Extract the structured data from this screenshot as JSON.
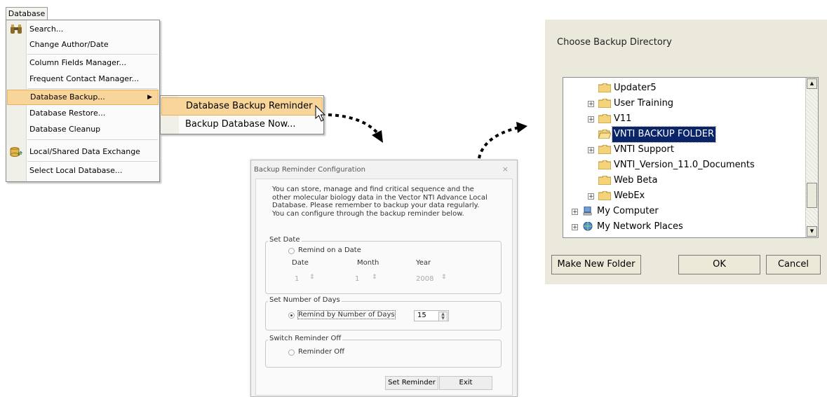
{
  "menu": {
    "tab_label": "Database",
    "items": [
      {
        "label": "Search...",
        "icon": "binoculars-icon"
      },
      {
        "label": "Change Author/Date"
      },
      {
        "label": "Column Fields Manager..."
      },
      {
        "label": "Frequent Contact Manager..."
      },
      {
        "label": "Database Backup...",
        "highlighted": true,
        "has_submenu": true
      },
      {
        "label": "Database Restore..."
      },
      {
        "label": "Database Cleanup"
      },
      {
        "label": "Local/Shared Data Exchange",
        "icon": "data-exchange-icon"
      },
      {
        "label": "Select Local Database..."
      }
    ],
    "submenu": [
      {
        "label": "Database Backup Reminder",
        "highlighted": true
      },
      {
        "label": "Backup Database Now..."
      }
    ],
    "highlight_color": "#f8d59a"
  },
  "reminder_dialog": {
    "title": "Backup Reminder Configuration",
    "close_glyph": "×",
    "description": "You can store, manage and find critical sequence and the other molecular biology data in the Vector NTI Advance Local Database. Please remember to backup your data regularly. You can configure through the  backup reminder below.",
    "set_date": {
      "group_title": "Set Date",
      "radio_label": "Remind on a Date",
      "selected": false,
      "date_label": "Date",
      "month_label": "Month",
      "year_label": "Year",
      "date_value": "1",
      "month_value": "1",
      "year_value": "2008"
    },
    "set_days": {
      "group_title": "Set Number of Days",
      "radio_label": "Remind by Number of Days",
      "selected": true,
      "days_value": "15"
    },
    "switch_off": {
      "group_title": "Switch Reminder Off",
      "radio_label": "Reminder Off",
      "selected": false
    },
    "set_reminder_label": "Set Reminder",
    "exit_label": "Exit"
  },
  "directory_dialog": {
    "title": "Choose Backup Directory",
    "tree": [
      {
        "label": "Updater5",
        "level": 2,
        "expandable": false
      },
      {
        "label": "User Training",
        "level": 2,
        "expandable": true
      },
      {
        "label": "V11",
        "level": 2,
        "expandable": true
      },
      {
        "label": "VNTI BACKUP FOLDER",
        "level": 2,
        "expandable": false,
        "selected": true
      },
      {
        "label": "VNTI Support",
        "level": 2,
        "expandable": true
      },
      {
        "label": "VNTI_Version_11.0_Documents",
        "level": 2,
        "expandable": false
      },
      {
        "label": "Web Beta",
        "level": 2,
        "expandable": false
      },
      {
        "label": "WebEx",
        "level": 2,
        "expandable": true
      },
      {
        "label": "My Computer",
        "level": 1,
        "expandable": true,
        "icon": "computer-icon"
      },
      {
        "label": "My Network Places",
        "level": 1,
        "expandable": true,
        "icon": "network-icon"
      }
    ],
    "make_new_folder_label": "Make New Folder",
    "ok_label": "OK",
    "cancel_label": "Cancel",
    "selection_color": "#0a246a"
  }
}
